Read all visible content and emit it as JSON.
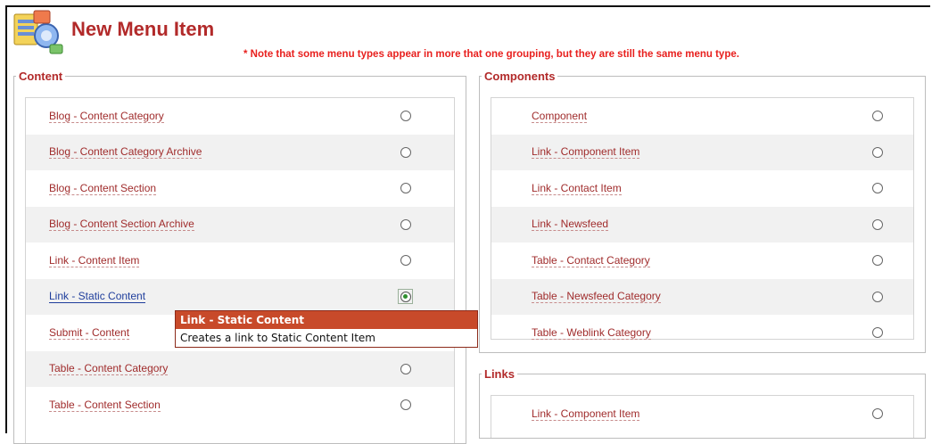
{
  "header": {
    "title": "New Menu Item",
    "note": "* Note that some menu types appear in more that one grouping, but they are still the same menu type."
  },
  "content_group": {
    "legend": "Content",
    "items": [
      {
        "label": "Blog - Content Category",
        "selected": false
      },
      {
        "label": "Blog - Content Category Archive",
        "selected": false
      },
      {
        "label": "Blog - Content Section",
        "selected": false
      },
      {
        "label": "Blog - Content Section Archive",
        "selected": false
      },
      {
        "label": "Link - Content Item",
        "selected": false
      },
      {
        "label": "Link - Static Content",
        "selected": true
      },
      {
        "label": "Submit - Content",
        "selected": false
      },
      {
        "label": "Table - Content Category",
        "selected": false
      },
      {
        "label": "Table - Content Section",
        "selected": false
      }
    ]
  },
  "components_group": {
    "legend": "Components",
    "items": [
      {
        "label": "Component",
        "selected": false
      },
      {
        "label": "Link - Component Item",
        "selected": false
      },
      {
        "label": "Link - Contact Item",
        "selected": false
      },
      {
        "label": "Link - Newsfeed",
        "selected": false
      },
      {
        "label": "Table - Contact Category",
        "selected": false
      },
      {
        "label": "Table - Newsfeed Category",
        "selected": false
      },
      {
        "label": "Table - Weblink Category",
        "selected": false
      }
    ]
  },
  "links_group": {
    "legend": "Links",
    "items": [
      {
        "label": "Link - Component Item",
        "selected": false
      }
    ]
  },
  "tooltip": {
    "title": "Link - Static Content",
    "body": "Creates a link to Static Content Item"
  },
  "colors": {
    "accent": "#b22a2a",
    "note": "#e8201e",
    "tooltip_header": "#c84a2a",
    "selected_link": "#1f3e9c"
  }
}
